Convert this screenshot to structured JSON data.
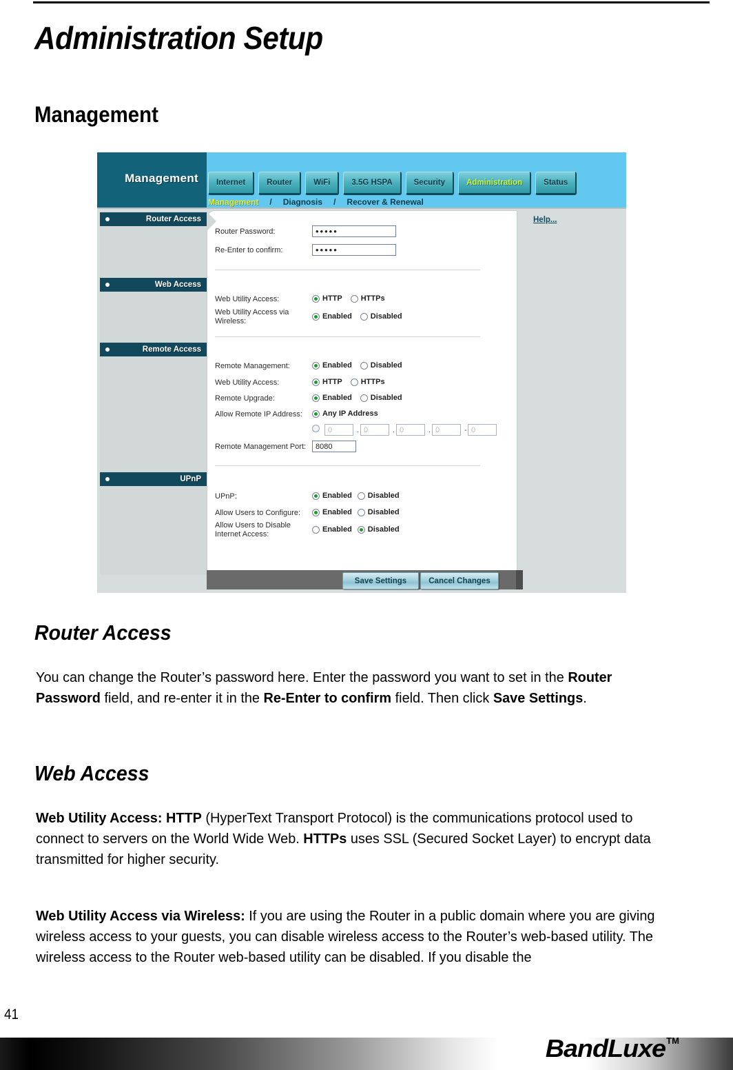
{
  "document": {
    "title": "Administration Setup",
    "section": "Management",
    "page_number": "41",
    "footer_logo": "BandLuxe",
    "footer_tm": "TM"
  },
  "screenshot": {
    "brand_panel": "Management",
    "tabs": [
      {
        "label": "Internet",
        "active": false
      },
      {
        "label": "Router",
        "active": false
      },
      {
        "label": "WiFi",
        "active": false
      },
      {
        "label": "3.5G HSPA",
        "active": false
      },
      {
        "label": "Security",
        "active": false
      },
      {
        "label": "Administration",
        "active": true
      },
      {
        "label": "Status",
        "active": false
      }
    ],
    "subnav": [
      {
        "label": "Management",
        "active": true
      },
      {
        "label": "Diagnosis",
        "active": false
      },
      {
        "label": "Recover & Renewal",
        "active": false
      }
    ],
    "subnav_separator": "/",
    "sidebar": [
      {
        "label": "Router Access"
      },
      {
        "label": "Web Access"
      },
      {
        "label": "Remote Access"
      },
      {
        "label": "UPnP"
      }
    ],
    "help_link": "Help...",
    "router_access": {
      "password_label": "Router Password:",
      "password_value": "•••••",
      "confirm_label": "Re-Enter to confirm:",
      "confirm_value": "•••••"
    },
    "web_access": {
      "utility_label": "Web Utility Access:",
      "utility_options": [
        "HTTP",
        "HTTPs"
      ],
      "utility_selected": "HTTP",
      "wireless_label": "Web Utility Access via Wireless:",
      "wireless_options": [
        "Enabled",
        "Disabled"
      ],
      "wireless_selected": "Enabled"
    },
    "remote_access": {
      "management_label": "Remote Management:",
      "management_options": [
        "Enabled",
        "Disabled"
      ],
      "management_selected": "Enabled",
      "utility_label": "Web Utility Access:",
      "utility_options": [
        "HTTP",
        "HTTPs"
      ],
      "utility_selected": "HTTP",
      "upgrade_label": "Remote Upgrade:",
      "upgrade_options": [
        "Enabled",
        "Disabled"
      ],
      "upgrade_selected": "Enabled",
      "allow_ip_label": "Allow Remote IP Address:",
      "any_ip_label": "Any IP Address",
      "any_ip_selected": true,
      "ip_octets": [
        "0",
        "0",
        "0",
        "0"
      ],
      "ip_range_end": "0",
      "ip_dot": ".",
      "ip_dash": "-",
      "port_label": "Remote Management Port:",
      "port_value": "8080"
    },
    "upnp": {
      "upnp_label": "UPnP:",
      "upnp_options": [
        "Enabled",
        "Disabled"
      ],
      "upnp_selected": "Enabled",
      "configure_label": "Allow Users to Configure:",
      "configure_options": [
        "Enabled",
        "Disabled"
      ],
      "configure_selected": "Enabled",
      "disable_internet_label": "Allow Users to Disable Internet Access:",
      "disable_internet_options": [
        "Enabled",
        "Disabled"
      ],
      "disable_internet_selected": "Disabled"
    },
    "buttons": {
      "save": "Save Settings",
      "cancel": "Cancel Changes"
    }
  },
  "sections": {
    "router_access": {
      "heading": "Router Access",
      "body_html": "You can change the Router&rsquo;s password here. Enter the password you want to set in the <b>Router Password</b> field, and re-enter it in the <b>Re-Enter to confirm</b> field. Then click <b>Save Settings</b>."
    },
    "web_access": {
      "heading": "Web Access",
      "para1_html": "<b>Web Utility Access: HTTP</b> (HyperText Transport Protocol) is the communications protocol used to connect to servers on the World Wide Web. <b>HTTPs</b> uses SSL (Secured Socket Layer) to encrypt data transmitted for higher security.",
      "para2_html": "<b>Web Utility Access via Wireless:</b> If you are using the Router in a public domain where you are giving wireless access to your guests, you can disable wireless access to the Router&rsquo;s web-based utility. The wireless access to the Router web-based utility can be disabled. If you disable the"
    }
  },
  "colors": {
    "brand_dark_teal": "#12627a",
    "header_blue": "#63c8ef",
    "nav_header": "#11485b",
    "active_tab_text": "#c6f542",
    "radio_on": "#1a9a2e",
    "panel_gray": "#d7dddc"
  }
}
